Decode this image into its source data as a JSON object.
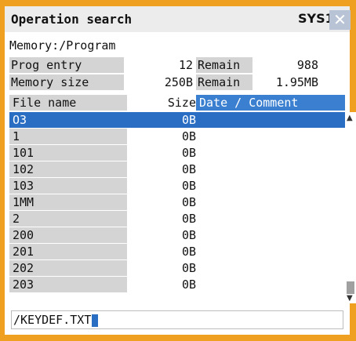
{
  "window": {
    "title": "Operation search",
    "system": "SYS1",
    "close_glyph": "✕"
  },
  "path": "Memory:/Program",
  "summary": {
    "prog_entry_label": "Prog entry",
    "prog_entry_value": "12",
    "prog_remain_label": "Remain",
    "prog_remain_value": "988",
    "memory_size_label": "Memory size",
    "memory_size_value": "250B",
    "memory_remain_label": "Remain",
    "memory_remain_value": "1.95MB"
  },
  "columns": {
    "file_name": "File name",
    "size": "Size",
    "date_comment": "Date / Comment"
  },
  "files": [
    {
      "name": "O3",
      "size": "0B",
      "selected": true
    },
    {
      "name": "1",
      "size": "0B"
    },
    {
      "name": "101",
      "size": "0B"
    },
    {
      "name": "102",
      "size": "0B"
    },
    {
      "name": "103",
      "size": "0B"
    },
    {
      "name": "1MM",
      "size": "0B"
    },
    {
      "name": "2",
      "size": "0B"
    },
    {
      "name": "200",
      "size": "0B"
    },
    {
      "name": "201",
      "size": "0B"
    },
    {
      "name": "202",
      "size": "0B"
    },
    {
      "name": "203",
      "size": "0B"
    }
  ],
  "input": {
    "value": "/KEYDEF.TXT"
  },
  "colors": {
    "frame": "#f0a020",
    "selection": "#2a6ec4",
    "header_accent": "#3a7fd0"
  },
  "icons": {
    "close": "close-icon",
    "scroll_up": "arrow-up-icon",
    "scroll_down": "arrow-down-icon"
  }
}
